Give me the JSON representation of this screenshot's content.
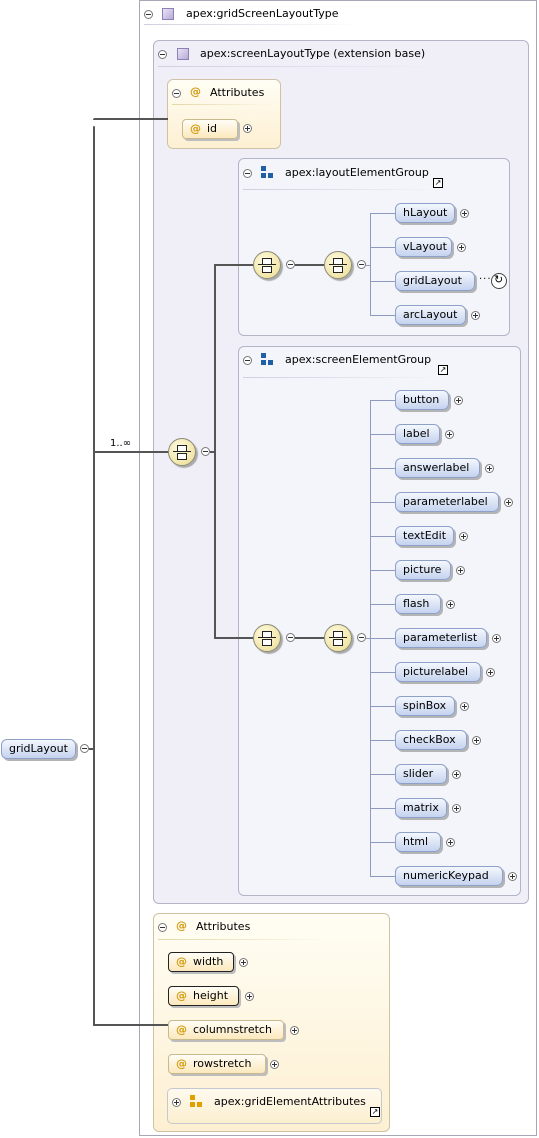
{
  "root": {
    "label": "gridLayout"
  },
  "outer_type": {
    "title": "apex:gridScreenLayoutType"
  },
  "extension": {
    "title": "apex:screenLayoutType (extension base)"
  },
  "attributes_top": {
    "title": "Attributes",
    "items": [
      {
        "name": "id"
      }
    ]
  },
  "layout_group": {
    "title": "apex:layoutElementGroup",
    "elements": [
      "hLayout",
      "vLayout",
      "gridLayout",
      "arcLayout"
    ]
  },
  "screen_group": {
    "title": "apex:screenElementGroup",
    "elements": [
      "button",
      "label",
      "answerlabel",
      "parameterlabel",
      "textEdit",
      "picture",
      "flash",
      "parameterlist",
      "picturelabel",
      "spinBox",
      "checkBox",
      "slider",
      "matrix",
      "html",
      "numericKeypad"
    ]
  },
  "cardinality": "1..∞",
  "attributes_bottom": {
    "title": "Attributes",
    "items": [
      {
        "name": "width",
        "required": true
      },
      {
        "name": "height",
        "required": true
      },
      {
        "name": "columnstretch",
        "required": false
      },
      {
        "name": "rowstretch",
        "required": false
      }
    ],
    "group_ref": "apex:gridElementAttributes"
  },
  "icons": {
    "type": "complex-type-cube-icon",
    "attribute": "at-sign-icon",
    "group": "group-blocks-icon",
    "link": "jump-arrow-icon",
    "compositor": "sequence-compositor-icon",
    "recursion": "recursion-icon"
  },
  "colors": {
    "element": "#c5d3ef",
    "attribute": "#fbe8bd",
    "compositor": "#eadb8f",
    "group_icon": "#1f5fa6",
    "attr_group_icon": "#e0a100"
  }
}
